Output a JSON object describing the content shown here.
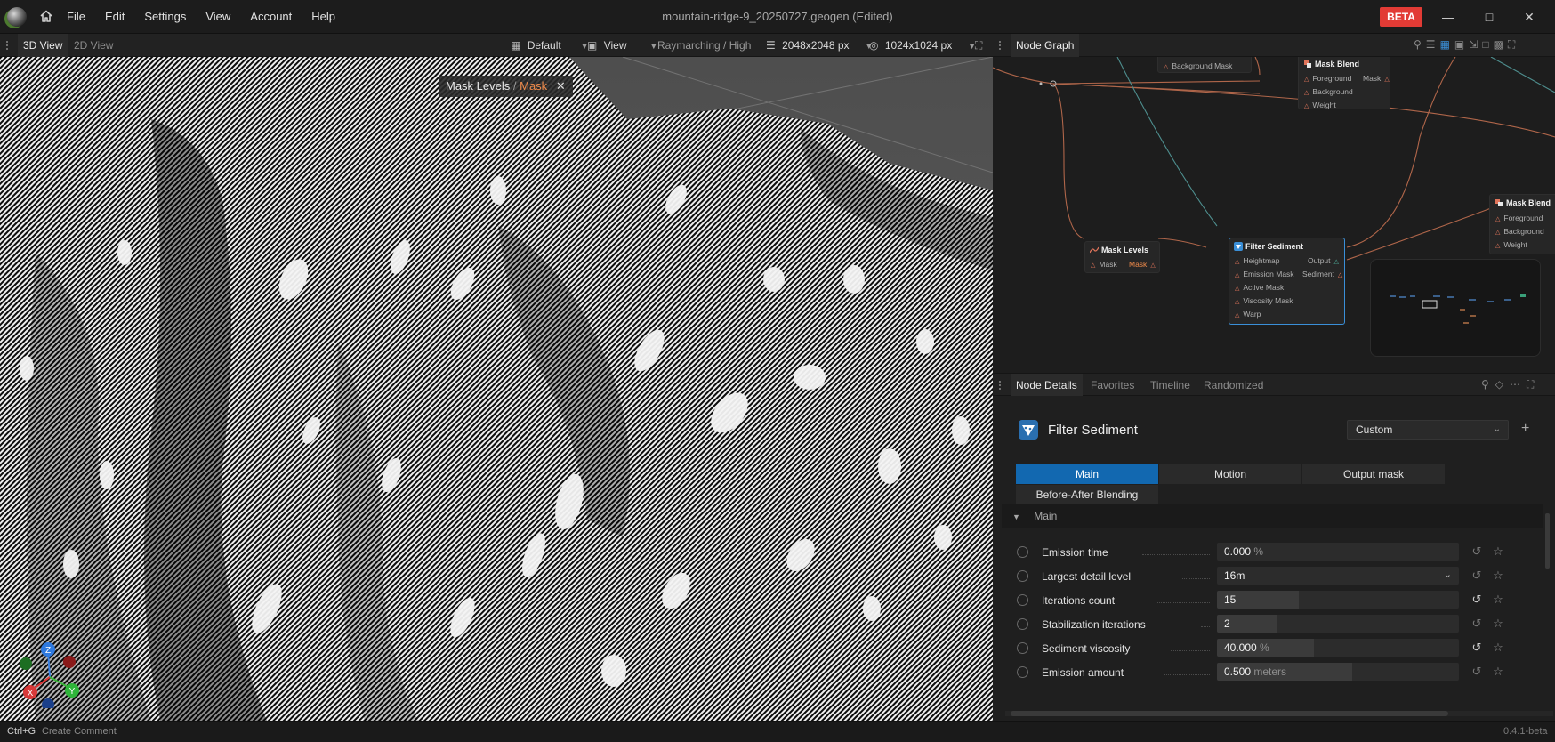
{
  "titlebar": {
    "menu": [
      "File",
      "Edit",
      "Settings",
      "View",
      "Account",
      "Help"
    ],
    "title": "mountain-ridge-9_20250727.geogen (Edited)",
    "badge": "BETA"
  },
  "viewport": {
    "tabs": [
      "3D View",
      "2D View"
    ],
    "preset": "Default",
    "view": "View",
    "render_mode": "Raymarching / High",
    "resolution": "2048x2048 px",
    "preview_resolution": "1024x1024 px",
    "breadcrumb": {
      "node": "Mask Levels",
      "separator": "/",
      "output": "Mask"
    },
    "gizmo_axes": [
      "Z",
      "X",
      "Y"
    ]
  },
  "node_graph": {
    "title": "Node Graph",
    "nodes": {
      "background_mask": {
        "port": "Background Mask"
      },
      "mask_blend_top": {
        "title": "Mask Blend",
        "inputs": [
          "Foreground",
          "Background",
          "Weight"
        ],
        "output": "Mask"
      },
      "mask_blend_right": {
        "title": "Mask Blend",
        "inputs": [
          "Foreground",
          "Background",
          "Weight"
        ]
      },
      "mask_levels": {
        "title": "Mask Levels",
        "input": "Mask",
        "output": "Mask"
      },
      "filter_sediment": {
        "title": "Filter Sediment",
        "inputs": [
          "Heightmap",
          "Emission Mask",
          "Active Mask",
          "Viscosity Mask",
          "Warp"
        ],
        "outputs": [
          "Output",
          "Sediment"
        ]
      }
    }
  },
  "node_details": {
    "tabs": [
      "Node Details",
      "Favorites",
      "Timeline",
      "Randomized"
    ],
    "node_name": "Filter Sediment",
    "preset": "Custom",
    "subtabs": [
      "Main",
      "Motion",
      "Output mask",
      "Before-After Blending"
    ],
    "section": "Main",
    "params": [
      {
        "label": "Emission time",
        "value": "0.000",
        "unit": "%",
        "fill": 0.0,
        "dropdown": false,
        "modified": false
      },
      {
        "label": "Largest detail level",
        "value": "16m",
        "unit": "",
        "fill": 0.0,
        "dropdown": true,
        "modified": false
      },
      {
        "label": "Iterations count",
        "value": "15",
        "unit": "",
        "fill": 0.34,
        "dropdown": false,
        "modified": true
      },
      {
        "label": "Stabilization iterations",
        "value": "2",
        "unit": "",
        "fill": 0.25,
        "dropdown": false,
        "modified": false
      },
      {
        "label": "Sediment viscosity",
        "value": "40.000",
        "unit": "%",
        "fill": 0.4,
        "dropdown": false,
        "modified": true
      },
      {
        "label": "Emission amount",
        "value": "0.500",
        "unit": "meters",
        "fill": 0.56,
        "dropdown": false,
        "modified": false
      }
    ]
  },
  "statusbar": {
    "shortcut": "Ctrl+G",
    "hint": "Create Comment",
    "version": "0.4.1-beta"
  },
  "colors": {
    "accent_blue": "#1268b0",
    "beta_red": "#e23b35",
    "breadcrumb_orange": "#f08b4b",
    "port_red": "#e0745a"
  }
}
